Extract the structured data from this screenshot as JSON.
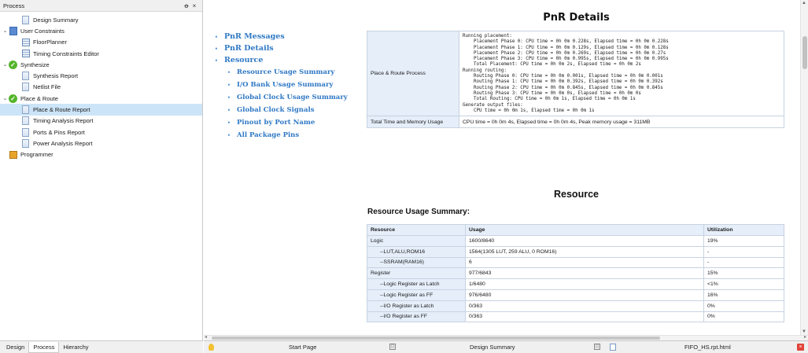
{
  "panel": {
    "title": "Process",
    "pin_glyph": "ꝋ",
    "close_glyph": "×"
  },
  "tree": [
    {
      "label": "Design Summary",
      "icon": "doc-icon",
      "level": 1
    },
    {
      "label": "User Constraints",
      "icon": "constraints-icon",
      "level": 0,
      "expanded": true
    },
    {
      "label": "FloorPlanner",
      "icon": "floorplanner-icon",
      "level": 1
    },
    {
      "label": "Timing Constraints Editor",
      "icon": "timing-editor-icon",
      "level": 1
    },
    {
      "label": "Synthesize",
      "icon": "check-icon",
      "level": 0,
      "expanded": true
    },
    {
      "label": "Synthesis Report",
      "icon": "doc-icon",
      "level": 1
    },
    {
      "label": "Netlist File",
      "icon": "doc-icon",
      "level": 1
    },
    {
      "label": "Place & Route",
      "icon": "check-icon",
      "level": 0,
      "expanded": true
    },
    {
      "label": "Place & Route Report",
      "icon": "doc-icon",
      "level": 1,
      "selected": true
    },
    {
      "label": "Timing Analysis Report",
      "icon": "doc-icon",
      "level": 1
    },
    {
      "label": "Ports & Pins Report",
      "icon": "doc-icon",
      "level": 1
    },
    {
      "label": "Power Analysis Report",
      "icon": "doc-icon",
      "level": 1
    },
    {
      "label": "Programmer",
      "icon": "programmer-icon",
      "level": 0
    }
  ],
  "bottom_tabs": [
    "Design",
    "Process",
    "Hierarchy"
  ],
  "toc": {
    "items": [
      "PnR Messages",
      "PnR Details",
      "Resource"
    ],
    "sub_items": [
      "Resource Usage Summary",
      "I/O Bank Usage Summary",
      "Global Clock Usage Summary",
      "Global Clock Signals",
      "Pinout by Port Name",
      "All Package Pins"
    ]
  },
  "pnr": {
    "title": "PnR Details",
    "rows": [
      {
        "label": "Place & Route Process",
        "value": "Running placement:\n    Placement Phase 0: CPU time = 0h 0m 0.228s, Elapsed time = 0h 0m 0.228s\n    Placement Phase 1: CPU time = 0h 0m 0.129s, Elapsed time = 0h 0m 0.128s\n    Placement Phase 2: CPU time = 0h 0m 0.269s, Elapsed time = 0h 0m 0.27s\n    Placement Phase 3: CPU time = 0h 0m 0.995s, Elapsed time = 0h 0m 0.995s\n    Total Placement: CPU time = 0h 0m 2s, Elapsed time = 0h 0m 2s\nRunning routing:\n    Routing Phase 0: CPU time = 0h 0m 0.001s, Elapsed time = 0h 0m 0.001s\n    Routing Phase 1: CPU time = 0h 0m 0.392s, Elapsed time = 0h 0m 0.392s\n    Routing Phase 2: CPU time = 0h 0m 0.845s, Elapsed time = 0h 0m 0.845s\n    Routing Phase 3: CPU time = 0h 0m 0s, Elapsed time = 0h 0m 0s\n    Total Routing: CPU time = 0h 0m 1s, Elapsed time = 0h 0m 1s\nGenerate output files:\n    CPU time = 0h 0m 1s, Elapsed time = 0h 0m 1s"
      },
      {
        "label": "Total Time and Memory Usage",
        "value": "CPU time = 0h 0m 4s, Elapsed time = 0h 0m 4s, Peak memory usage = 311MB"
      }
    ]
  },
  "resource": {
    "title": "Resource",
    "usage_title": "Resource Usage Summary:",
    "headers": [
      "Resource",
      "Usage",
      "Utilization"
    ],
    "rows": [
      [
        "Logic",
        "1600/8640",
        "19%"
      ],
      [
        "--LUT,ALU,ROM16",
        "1564(1305 LUT, 259 ALU, 0 ROM16)",
        "-"
      ],
      [
        "--SSRAM(RAM16)",
        "6",
        "-"
      ],
      [
        "Register",
        "977/6843",
        "15%"
      ],
      [
        "--Logic Register as Latch",
        "1/6480",
        "<1%"
      ],
      [
        "--Logic Register as FF",
        "976/6480",
        "16%"
      ],
      [
        "--I/O Register as Latch",
        "0/363",
        "0%"
      ],
      [
        "--I/O Register as FF",
        "0/363",
        "0%"
      ]
    ]
  },
  "doc_tabs": [
    {
      "label": "Start Page",
      "icon": "lamp-icon"
    },
    {
      "label": "Design Summary",
      "icon": "none"
    },
    {
      "label": "FIFO_HS.rpt.html",
      "icon": "doc-icon"
    }
  ],
  "colors": {
    "link": "#2f78c4",
    "selected_row": "#cce4f7",
    "table_label_bg": "#e5eef9",
    "check_green": "#55b52c"
  }
}
